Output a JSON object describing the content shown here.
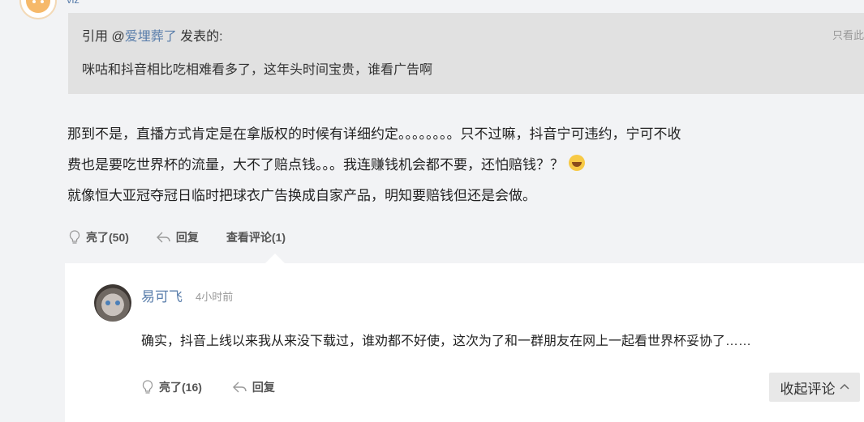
{
  "top_user": {
    "name": "viz"
  },
  "quote": {
    "prefix": "引用 @",
    "author": "爱埋葬了",
    "suffix": " 发表的:",
    "only_view": "只看此",
    "body": "咪咕和抖音相比吃相难看多了，这年头时间宝贵，谁看广告啊"
  },
  "post": {
    "line1": "那到不是，直播方式肯定是在拿版权的时候有详细约定。。。。。。。。只不过嘛，抖音宁可违约，宁可不收",
    "line2": "费也是要吃世界杯的流量，大不了赔点钱。。。我连赚钱机会都不要，还怕赔钱？？",
    "line3": "就像恒大亚冠夺冠日临时把球衣广告换成自家产品，明知要赔钱但还是会做。",
    "emoji": "laugh-cry-emoji"
  },
  "actions": {
    "like_label": "亮了(50)",
    "reply_label": "回复",
    "view_comments_label": "查看评论(1)"
  },
  "comment": {
    "author": "易可飞",
    "time": "4小时前",
    "text": "确实，抖音上线以来我从来没下载过，谁劝都不好使，这次为了和一群朋友在网上一起看世界杯妥协了……",
    "like_label": "亮了(16)",
    "reply_label": "回复",
    "collapse_label": "收起评论",
    "collapse_icon": "chevron-up-icon"
  },
  "colors": {
    "link": "#5a7eab",
    "quote_bg": "#e1e1e1",
    "page_bg": "#f2f3f5"
  }
}
